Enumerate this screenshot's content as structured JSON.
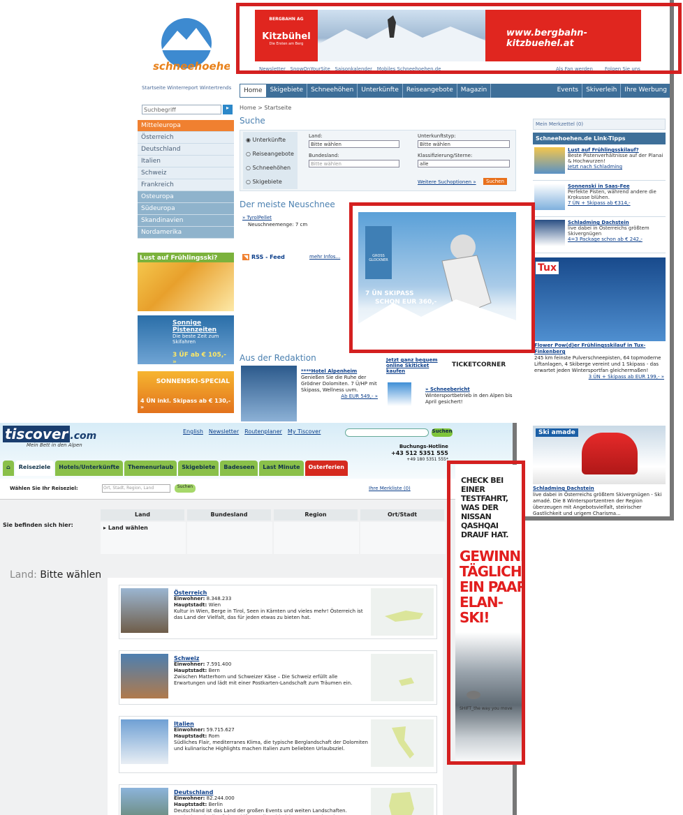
{
  "screen1": {
    "logo_text": "Schneehoehen.de",
    "banner": {
      "brand_top": "BERGBAHN AG",
      "brand": "Kitzbühel",
      "tagline": "Die Ersten am Berg",
      "url": "www.bergbahn-kitzbuehel.at"
    },
    "topnav": [
      "Newsletter",
      "SnowOnYourSite",
      "Saisonkalender",
      "Mobiles Schneehoehen.de",
      "Als Fan werden",
      "Folgen Sie uns"
    ],
    "small_links": "Startseite  Winterreport  Wintertrends",
    "tabs": [
      "Home",
      "Skigebiete",
      "Schneehöhen",
      "Unterkünfte",
      "Reiseangebote",
      "Magazin"
    ],
    "tabs_right": [
      "Events",
      "Skiverleih",
      "Ihre Werbung"
    ],
    "search_placeholder": "Suchbegriff",
    "sidebar": [
      "Mitteleuropa",
      "Österreich",
      "Deutschland",
      "Italien",
      "Schweiz",
      "Frankreich",
      "Osteuropa",
      "Südeuropa",
      "Skandinavien",
      "Nordamerika"
    ],
    "promo1": "Lust auf Frühlingsski?",
    "promo2_title": "Sonnige Pistenzeiten",
    "promo2_text": "Die beste Zeit zum Skifahren",
    "promo2_price": "3 ÜF ab € 105,- »",
    "promo3_title": "SONNENSKI-SPECIAL",
    "promo3_price": "4 ÜN inkl. Skipass ab € 130,- »",
    "breadcrumb": "Home >  Startseite",
    "suche_title": "Suche",
    "suche_radios": [
      "Unterkünfte",
      "Reiseangebote",
      "Schneehöhen",
      "Skigebiete"
    ],
    "land_label": "Land:",
    "land_val": "Bitte wählen",
    "bundesland_label": "Bundesland:",
    "bundesland_val": "Bitte wählen",
    "unterkunft_label": "Unterkunftstyp:",
    "unterkunft_val": "Bitte wählen",
    "klass_label": "Klassifizierung/Sterne:",
    "klass_val": "alle",
    "weitere": "Weitere Suchoptionen »",
    "suchen": "Suchen",
    "neuschnee_title": "Der meiste Neuschnee",
    "neuschnee_item": "» TyrolPellet",
    "neuschnee_menge": "Neuschneemenge: 7 cm",
    "rss": "RSS - Feed",
    "mehr": "mehr Infos...",
    "ad_text1": "GROSS GLOCKNER",
    "ad_text2": "7 ÜN  SKIPASS",
    "ad_text3": "SCHON  EUR 360,-",
    "redaktion_title": "Aus der Redaktion",
    "hotel_name": "****Hotel Alpenheim",
    "hotel_text": "Genießen Sie die Ruhe der Grödner Dolomiten. 7 Ü/HP mit Skipass, Wellness uvm.",
    "hotel_price": "Ab EUR 549,- »",
    "ticket_link": "Jetzt ganz bequem online Skiticket kaufen",
    "ticket_brand": "TICKETCORNER",
    "bericht_title": "» Schneebericht",
    "bericht_text": "Wintersportbetrieb in den Alpen bis April gesichert!",
    "merkzettel": "Mein Merkzettel (0)",
    "linktipps": "Schneehoehen.de Link-Tipps",
    "tipps": [
      {
        "title": "Lust auf Frühlingsskilauf?",
        "text": "Beste Pistenverhältnisse auf der Planai & Hochwurzen!",
        "link": "Jetzt nach Schladming"
      },
      {
        "title": "Sonnenski in Saas-Fee",
        "text": "Perfekte Pisten, während andere die Krokusse blühen.",
        "link": "7 ÜN + Skipass ab €314,-"
      },
      {
        "title": "Schladming Dachstein",
        "text": "live dabei in Österreichs größtem Skivergnügen",
        "link": "4=3 Package schon ab € 242,-"
      }
    ],
    "tux_title": "Flower Pow(d)er Frühlingsskilauf in Tux-Finkenberg",
    "tux_text": "245 km feinste Pulverschneepisten, 64 topmoderne Liftanlagen, 4 Skiberge vereint und 1 Skipass - das erwartet jeden Wintersportfan gleichermaßen!",
    "tux_price": "3 ÜN + Skipass ab EUR 199,- »",
    "skiamade": "Ski amade",
    "schlad_title": "Schladming Dachstein",
    "schlad_text": "live dabei in Österreichs größtem Skivergnügen - Ski amadé. Die 8 Wintersportzentren der Region überzeugen mit Angebotsvielfalt, steirischer Gastlichkeit und urigem Charisma..."
  },
  "screen2": {
    "logo": "tiscover",
    "logo_suffix": ".com",
    "tagline": "Mein Bett in den Alpen",
    "toplinks": [
      "English",
      "Newsletter",
      "Routenplaner",
      "My Tiscover"
    ],
    "suchen": "Suchen",
    "hotline_label": "Buchungs-Hotline",
    "hotline1": "+43 512 5351 555",
    "hotline2": "+49 180 5351 555*",
    "nav": [
      "Reiseziele",
      "Hotels/Unterkünfte",
      "Themenurlaub",
      "Skigebiete",
      "Badeseen",
      "Last Minute",
      "Osterferien"
    ],
    "waehlen": "Wählen Sie Ihr Reiseziel:",
    "waehlen_placeholder": "Ort, Stadt, Region, Land",
    "waehlen_btn": "Suchen",
    "merkliste": "Ihre Merkliste (0)",
    "befinden": "Sie befinden sich hier:",
    "loc_headers": [
      "Land",
      "Bundesland",
      "Region",
      "Ort/Stadt"
    ],
    "land_waehlen": "Land wählen",
    "land_prefix": "Land:",
    "land_value": "Bitte wählen",
    "countries": [
      {
        "name": "Österreich",
        "einwohner": "8.348.233",
        "hauptstadt": "Wien",
        "text": "Kultur in Wien, Berge in Tirol, Seen in Kärnten und vieles mehr! Österreich ist das Land der Vielfalt, das für jeden etwas zu bieten hat."
      },
      {
        "name": "Schweiz",
        "einwohner": "7.591.400",
        "hauptstadt": "Bern",
        "text": "Zwischen Matterhorn und Schweizer Käse – Die Schweiz erfüllt alle Erwartungen und lädt mit einer Postkarten-Landschaft zum Träumen ein."
      },
      {
        "name": "Italien",
        "einwohner": "59.715.627",
        "hauptstadt": "Rom",
        "text": "Südliches Flair, mediterranes Klima, die typische Berglandschaft der Dolomiten und kulinarische Highlights machen Italien zum beliebten Urlaubsziel."
      },
      {
        "name": "Deutschland",
        "einwohner": "82.244.000",
        "hauptstadt": "Berlin",
        "text": "Deutschland ist das Land der großen Events und weiten Landschaften. Entdecken Sie die Königsschlösser, die zahlreichen Naturparks oder"
      }
    ],
    "einwohner_label": "Einwohner:",
    "hauptstadt_label": "Hauptstadt:"
  },
  "screen3": {
    "line1": "CHECK BEI EINER TESTFAHRT, WAS DER NISSAN QASHQAI DRAUF HAT.",
    "line2": "GEWINNE TÄGLICH EIN PAAR ELAN-SKI!",
    "brand": "NISSAN",
    "slogan": "SHIFT_the way you move"
  },
  "colors": {
    "highlight_box": "#d42020",
    "nav_blue": "#3e6f99",
    "tiscover_green": "#8ac04a",
    "orange": "#f08030"
  }
}
